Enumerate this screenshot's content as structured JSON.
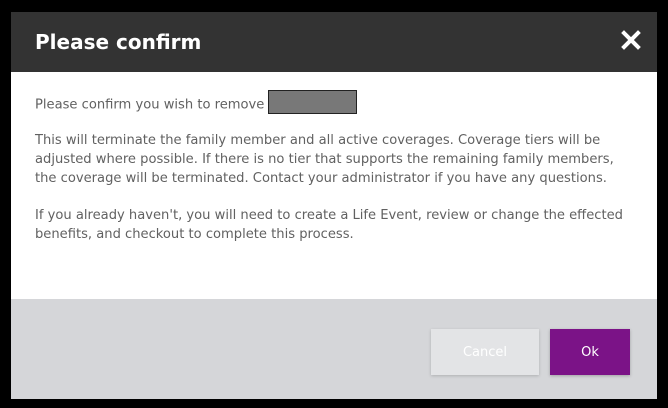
{
  "dialog": {
    "title": "Please confirm",
    "close_icon": "close-icon",
    "confirm_text": "Please confirm you wish to remove",
    "paragraph_1": "This will terminate the family member and all active coverages. Coverage tiers will be adjusted where possible. If there is no tier that supports the remaining family members, the coverage will be terminated. Contact your administrator if you have any questions.",
    "paragraph_2": "If you already haven't, you will need to create a Life Event, review or change the effected benefits, and checkout to complete this process.",
    "cancel_label": "Cancel",
    "ok_label": "Ok"
  },
  "colors": {
    "header_bg": "#333333",
    "footer_bg": "#d5d6d9",
    "accent": "#7b1387",
    "body_text": "#616161"
  }
}
